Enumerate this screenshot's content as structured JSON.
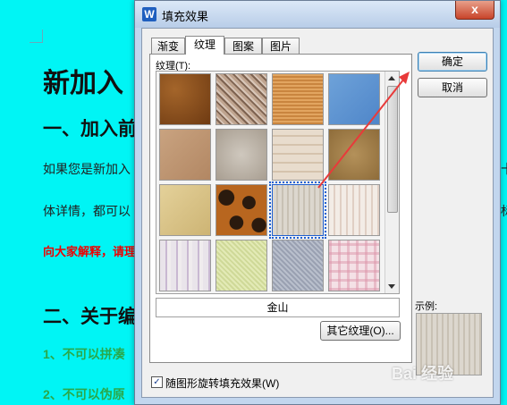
{
  "document": {
    "heading1": "新加入​",
    "heading2a": "一、加入前",
    "para1": "如果您是新加入",
    "para2": "体详情，都可以",
    "red_line": "向大家解释，请理",
    "heading2b": "二、关于编",
    "green1": "1、不可以拼凑",
    "green2": "2、不可以伪原",
    "right_char1": "十",
    "right_char2": "标"
  },
  "dialog": {
    "title": "填充效果",
    "app_icon": "W",
    "close_label": "x",
    "tabs": [
      "渐变",
      "纹理",
      "图案",
      "图片"
    ],
    "active_tab": "纹理",
    "texture_label": "纹理(T):",
    "selected_texture_name": "金山",
    "other_texture_button": "其它纹理(O)...",
    "ok_button": "确定",
    "cancel_button": "取消",
    "sample_label": "示例:",
    "rotate_checkbox_label": "随图形旋转填充效果(W)",
    "rotate_checked": true,
    "accent_color": "#2060d0"
  },
  "textures": [
    "brown-leather",
    "woven-mat",
    "burlap",
    "blue-tissue",
    "light-brown-paper",
    "granite",
    "parchment",
    "cork",
    "papyrus",
    "leopard",
    "newsprint-letters",
    "white-stripes",
    "striped-fabric",
    "green-cloth",
    "denim",
    "pink-plaid"
  ],
  "watermark": "Bai 经验"
}
